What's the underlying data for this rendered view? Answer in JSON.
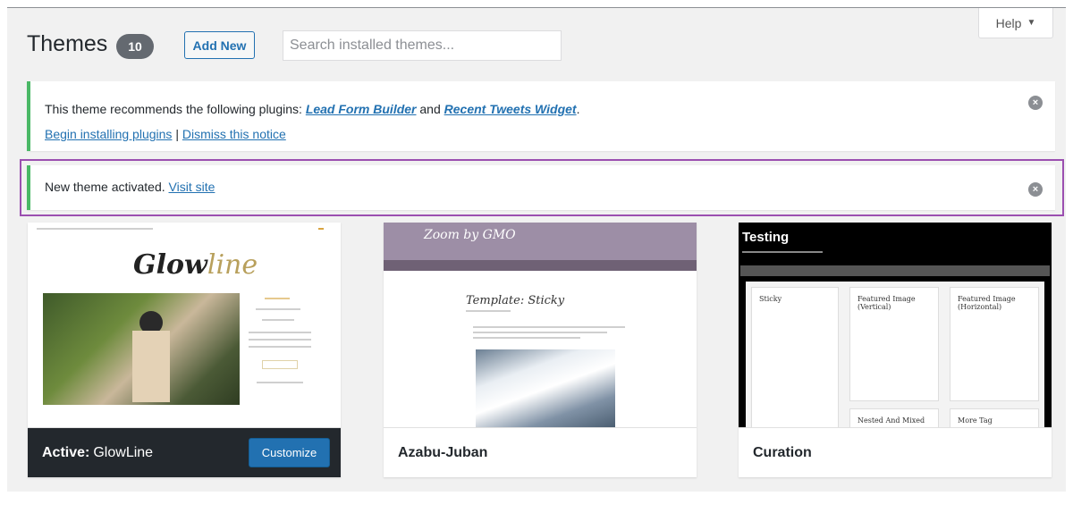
{
  "header": {
    "title": "Themes",
    "count": "10",
    "add_new_label": "Add New",
    "search_placeholder": "Search installed themes...",
    "help_label": "Help"
  },
  "notices": {
    "plugins": {
      "text_before": "This theme recommends the following plugins: ",
      "plugin1": "Lead Form Builder",
      "between": " and ",
      "plugin2": "Recent Tweets Widget",
      "after": ".",
      "begin_link": "Begin installing plugins",
      "separator": " | ",
      "dismiss_link": "Dismiss this notice"
    },
    "activated": {
      "text": "New theme activated. ",
      "visit_link": "Visit site"
    },
    "accent_color": "#4ab866",
    "highlight_color": "#9b4fb0"
  },
  "themes": [
    {
      "name": "GlowLine",
      "active_prefix": "Active:",
      "customize_label": "Customize",
      "logo_main": "Glow",
      "logo_accent": "line"
    },
    {
      "name": "Azabu-Juban",
      "header_text": "Zoom by GMO",
      "post_title": "Template: Sticky"
    },
    {
      "name": "Curation",
      "site_title": "Testing",
      "card_titles": [
        "Sticky",
        "Featured Image (Vertical)",
        "Featured Image (Horizontal)",
        "Nested And Mixed",
        "More Tag"
      ]
    }
  ],
  "colors": {
    "primary_button": "#2271b1",
    "active_bar": "#23282d",
    "count_badge": "#646970"
  }
}
